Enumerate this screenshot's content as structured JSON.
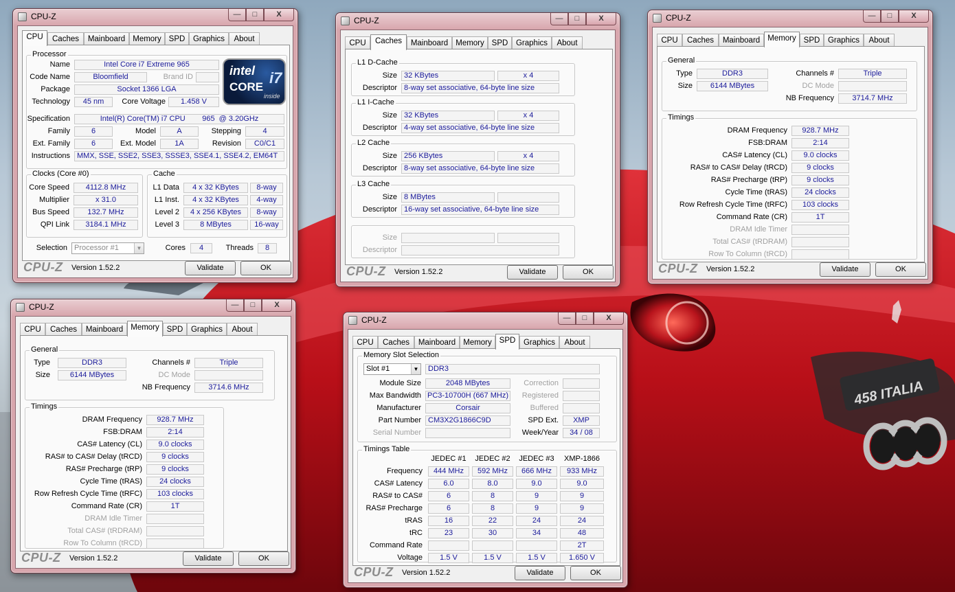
{
  "app_title": "CPU-Z",
  "tabs": [
    "CPU",
    "Caches",
    "Mainboard",
    "Memory",
    "SPD",
    "Graphics",
    "About"
  ],
  "footer": {
    "logo": "CPU-Z",
    "version": "Version 1.52.2",
    "validate": "Validate",
    "ok": "OK"
  },
  "window_caps": {
    "minimize": "—",
    "maximize": "□",
    "close": "X"
  },
  "cpu": {
    "grp_processor": "Processor",
    "lbl": {
      "name": "Name",
      "code_name": "Code Name",
      "brand_id": "Brand ID",
      "package": "Package",
      "technology": "Technology",
      "core_voltage": "Core Voltage",
      "specification": "Specification",
      "family": "Family",
      "model": "Model",
      "stepping": "Stepping",
      "ext_family": "Ext. Family",
      "ext_model": "Ext. Model",
      "revision": "Revision",
      "instructions": "Instructions"
    },
    "name": "Intel Core i7 Extreme 965",
    "code_name": "Bloomfield",
    "brand_id": "",
    "package": "Socket 1366 LGA",
    "technology": "45 nm",
    "core_voltage": "1.458 V",
    "specification": "Intel(R) Core(TM) i7 CPU        965  @ 3.20GHz",
    "family": "6",
    "model": "A",
    "stepping": "4",
    "ext_family": "6",
    "ext_model": "1A",
    "revision": "C0/C1",
    "instructions": "MMX, SSE, SSE2, SSE3, SSSE3, SSE4.1, SSE4.2, EM64T",
    "logo": {
      "brand": "intel",
      "line": "CORE",
      "model": "i7",
      "tag": "inside"
    },
    "grp_clocks": "Clocks (Core #0)",
    "clk_lbl": {
      "core_speed": "Core Speed",
      "multiplier": "Multiplier",
      "bus_speed": "Bus Speed",
      "qpi_link": "QPI Link"
    },
    "core_speed": "4112.8 MHz",
    "multiplier": "x 31.0",
    "bus_speed": "132.7 MHz",
    "qpi_link": "3184.1 MHz",
    "grp_cache": "Cache",
    "cache_rows": [
      {
        "label": "L1 Data",
        "size": "4 x 32 KBytes",
        "way": "8-way"
      },
      {
        "label": "L1 Inst.",
        "size": "4 x 32 KBytes",
        "way": "4-way"
      },
      {
        "label": "Level 2",
        "size": "4 x 256 KBytes",
        "way": "8-way"
      },
      {
        "label": "Level 3",
        "size": "8 MBytes",
        "way": "16-way"
      }
    ],
    "sel_lbl": "Selection",
    "selection": "Processor #1",
    "cores_lbl": "Cores",
    "cores": "4",
    "threads_lbl": "Threads",
    "threads": "8"
  },
  "caches": {
    "size_lbl": "Size",
    "desc_lbl": "Descriptor",
    "groups": [
      {
        "title": "L1 D-Cache",
        "size": "32 KBytes",
        "count": "x 4",
        "desc": "8-way set associative, 64-byte line size"
      },
      {
        "title": "L1 I-Cache",
        "size": "32 KBytes",
        "count": "x 4",
        "desc": "4-way set associative, 64-byte line size"
      },
      {
        "title": "L2 Cache",
        "size": "256 KBytes",
        "count": "x 4",
        "desc": "8-way set associative, 64-byte line size"
      },
      {
        "title": "L3 Cache",
        "size": "8 MBytes",
        "count": "",
        "desc": "16-way set associative, 64-byte line size"
      }
    ]
  },
  "memory_top": {
    "grp_general": "General",
    "type_lbl": "Type",
    "type": "DDR3",
    "size_lbl": "Size",
    "size": "6144 MBytes",
    "channels_lbl": "Channels #",
    "channels": "Triple",
    "dc_mode_lbl": "DC Mode",
    "dc_mode": "",
    "nb_freq_lbl": "NB Frequency",
    "nb_freq": "3714.7 MHz",
    "grp_timings": "Timings",
    "timings": [
      {
        "label": "DRAM Frequency",
        "value": "928.7 MHz"
      },
      {
        "label": "FSB:DRAM",
        "value": "2:14"
      },
      {
        "label": "CAS# Latency (CL)",
        "value": "9.0 clocks"
      },
      {
        "label": "RAS# to CAS# Delay (tRCD)",
        "value": "9 clocks"
      },
      {
        "label": "RAS# Precharge (tRP)",
        "value": "9 clocks"
      },
      {
        "label": "Cycle Time (tRAS)",
        "value": "24 clocks"
      },
      {
        "label": "Row Refresh Cycle Time (tRFC)",
        "value": "103 clocks"
      },
      {
        "label": "Command Rate (CR)",
        "value": "1T"
      }
    ],
    "timings_dim": [
      "DRAM Idle Timer",
      "Total CAS# (tRDRAM)",
      "Row To Column (tRCD)"
    ]
  },
  "memory_bottom": {
    "grp_general": "General",
    "type_lbl": "Type",
    "type": "DDR3",
    "size_lbl": "Size",
    "size": "6144 MBytes",
    "channels_lbl": "Channels #",
    "channels": "Triple",
    "dc_mode_lbl": "DC Mode",
    "dc_mode": "",
    "nb_freq_lbl": "NB Frequency",
    "nb_freq": "3714.6 MHz",
    "grp_timings": "Timings",
    "timings": [
      {
        "label": "DRAM Frequency",
        "value": "928.7 MHz"
      },
      {
        "label": "FSB:DRAM",
        "value": "2:14"
      },
      {
        "label": "CAS# Latency (CL)",
        "value": "9.0 clocks"
      },
      {
        "label": "RAS# to CAS# Delay (tRCD)",
        "value": "9 clocks"
      },
      {
        "label": "RAS# Precharge (tRP)",
        "value": "9 clocks"
      },
      {
        "label": "Cycle Time (tRAS)",
        "value": "24 clocks"
      },
      {
        "label": "Row Refresh Cycle Time (tRFC)",
        "value": "103 clocks"
      },
      {
        "label": "Command Rate (CR)",
        "value": "1T"
      }
    ],
    "timings_dim": [
      "DRAM Idle Timer",
      "Total CAS# (tRDRAM)",
      "Row To Column (tRCD)"
    ]
  },
  "spd": {
    "grp_slot": "Memory Slot Selection",
    "slot": "Slot #1",
    "slot_type": "DDR3",
    "lbl": {
      "module_size": "Module Size",
      "max_bw": "Max Bandwidth",
      "manufacturer": "Manufacturer",
      "part_number": "Part Number",
      "serial": "Serial Number",
      "correction": "Correction",
      "registered": "Registered",
      "buffered": "Buffered",
      "spd_ext": "SPD Ext.",
      "week_year": "Week/Year"
    },
    "module_size": "2048 MBytes",
    "max_bw": "PC3-10700H (667 MHz)",
    "manufacturer": "Corsair",
    "part_number": "CM3X2G1866C9D",
    "serial": "",
    "spd_ext": "XMP",
    "week_year": "34 / 08",
    "grp_table": "Timings Table",
    "columns": [
      "JEDEC #1",
      "JEDEC #2",
      "JEDEC #3",
      "XMP-1866"
    ],
    "rows": [
      {
        "label": "Frequency",
        "values": [
          "444 MHz",
          "592 MHz",
          "666 MHz",
          "933 MHz"
        ]
      },
      {
        "label": "CAS# Latency",
        "values": [
          "6.0",
          "8.0",
          "9.0",
          "9.0"
        ]
      },
      {
        "label": "RAS# to CAS#",
        "values": [
          "6",
          "8",
          "9",
          "9"
        ]
      },
      {
        "label": "RAS# Precharge",
        "values": [
          "6",
          "8",
          "9",
          "9"
        ]
      },
      {
        "label": "tRAS",
        "values": [
          "16",
          "22",
          "24",
          "24"
        ]
      },
      {
        "label": "tRC",
        "values": [
          "23",
          "30",
          "34",
          "48"
        ]
      },
      {
        "label": "Command Rate",
        "values": [
          "",
          "",
          "",
          "2T"
        ]
      },
      {
        "label": "Voltage",
        "values": [
          "1.5 V",
          "1.5 V",
          "1.5 V",
          "1.650 V"
        ]
      }
    ]
  },
  "car_badge": "458 ITALIA",
  "colors": {
    "value_text": "#1a1a9a",
    "window_frame": "#d8a6ad",
    "car_red": "#c8101a"
  }
}
